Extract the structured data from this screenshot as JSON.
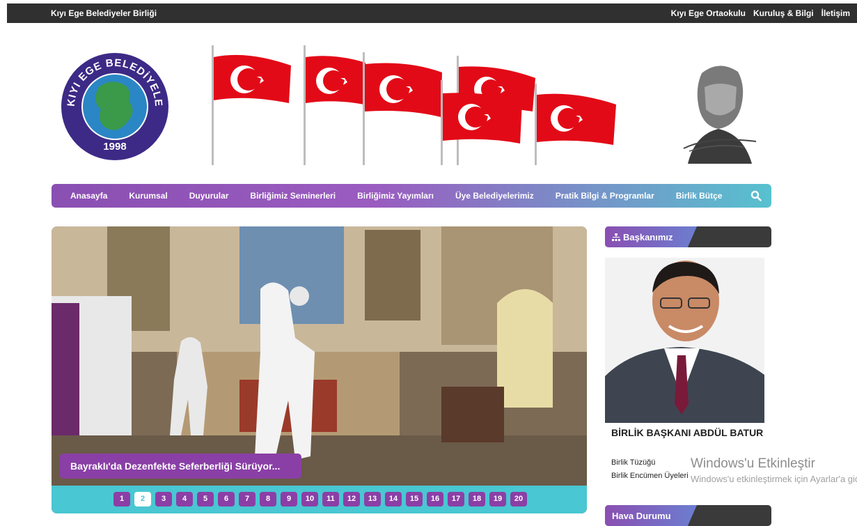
{
  "topbar": {
    "site_title": "Kıyı Ege Belediyeler Birliği",
    "links": [
      "Kıyı Ege Ortaokulu",
      "Kuruluş & Bilgi",
      "İletişim"
    ]
  },
  "logo": {
    "arc_text": "KIYI EGE BELEDİYELER BİRLİĞİ",
    "year": "1998"
  },
  "nav": {
    "items": [
      "Anasayfa",
      "Kurumsal",
      "Duyurular",
      "Birliğimiz Seminerleri",
      "Birliğimiz Yayımları",
      "Üye Belediyelerimiz",
      "Pratik Bilgi & Programlar",
      "Birlik Bütçe"
    ],
    "search_icon": "search-icon"
  },
  "slider": {
    "caption": "Bayraklı'da Dezenfekte Seferberliği Sürüyor...",
    "pages": [
      "1",
      "2",
      "3",
      "4",
      "5",
      "6",
      "7",
      "8",
      "9",
      "10",
      "11",
      "12",
      "13",
      "14",
      "15",
      "16",
      "17",
      "18",
      "19",
      "20"
    ],
    "active_page": "2"
  },
  "sidebar": {
    "section_title": "Başkanımız",
    "mayor_name": "BİRLİK BAŞKANI ABDÜL BATUR",
    "links": [
      "Birlik Tüzüğü",
      "Birlik Encümen Üyeleri"
    ],
    "next_section_title": "Hava Durumu"
  },
  "watermark": {
    "line1": "Windows'u Etkinleştir",
    "line2": "Windows'u etkinleştirmek için Ayarlar'a gidin."
  },
  "colors": {
    "topbar": "#303030",
    "nav_purple": "#8a4fb2",
    "nav_teal": "#57c1cf",
    "pager_teal": "#49c7d2",
    "page_purple": "#8b3fa6",
    "flag_red": "#e30a17"
  }
}
